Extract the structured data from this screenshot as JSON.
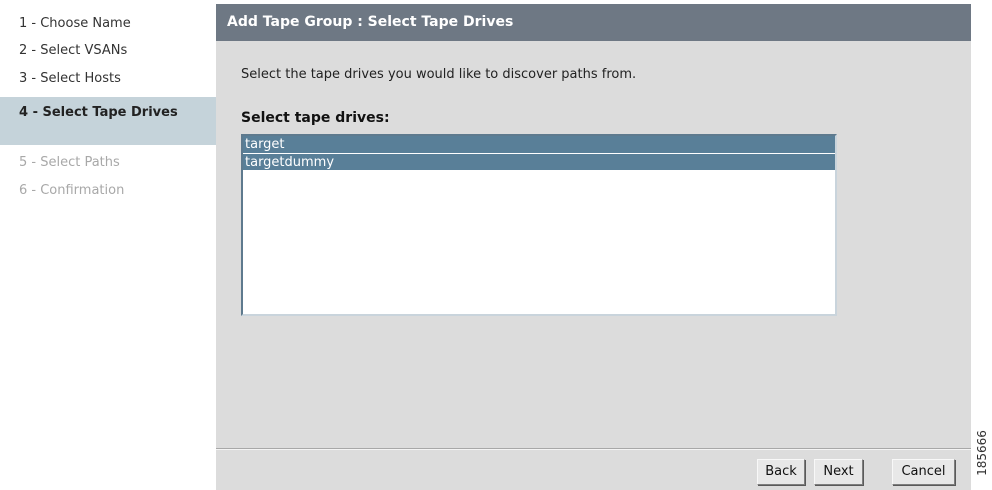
{
  "sidebar": {
    "steps": [
      {
        "label": "1 - Choose Name",
        "state": "done"
      },
      {
        "label": "2 - Select VSANs",
        "state": "done"
      },
      {
        "label": "3 - Select Hosts",
        "state": "done"
      },
      {
        "label": "4 - Select Tape Drives",
        "state": "active"
      },
      {
        "label": "5 - Select Paths",
        "state": "disabled"
      },
      {
        "label": "6 - Confirmation",
        "state": "disabled"
      }
    ]
  },
  "panel": {
    "title": "Add Tape Group : Select Tape Drives",
    "description": "Select the tape drives you would like to discover paths from.",
    "list_label": "Select tape drives:",
    "items": [
      "target",
      "targetdummy"
    ]
  },
  "buttons": {
    "back": "Back",
    "next": "Next",
    "cancel": "Cancel"
  },
  "figure_number": "185666",
  "colors": {
    "title_bar": "#6e7884",
    "active_step": "#c5d3da",
    "selected_item": "#597f98",
    "panel_bg": "#dcdcdc"
  }
}
